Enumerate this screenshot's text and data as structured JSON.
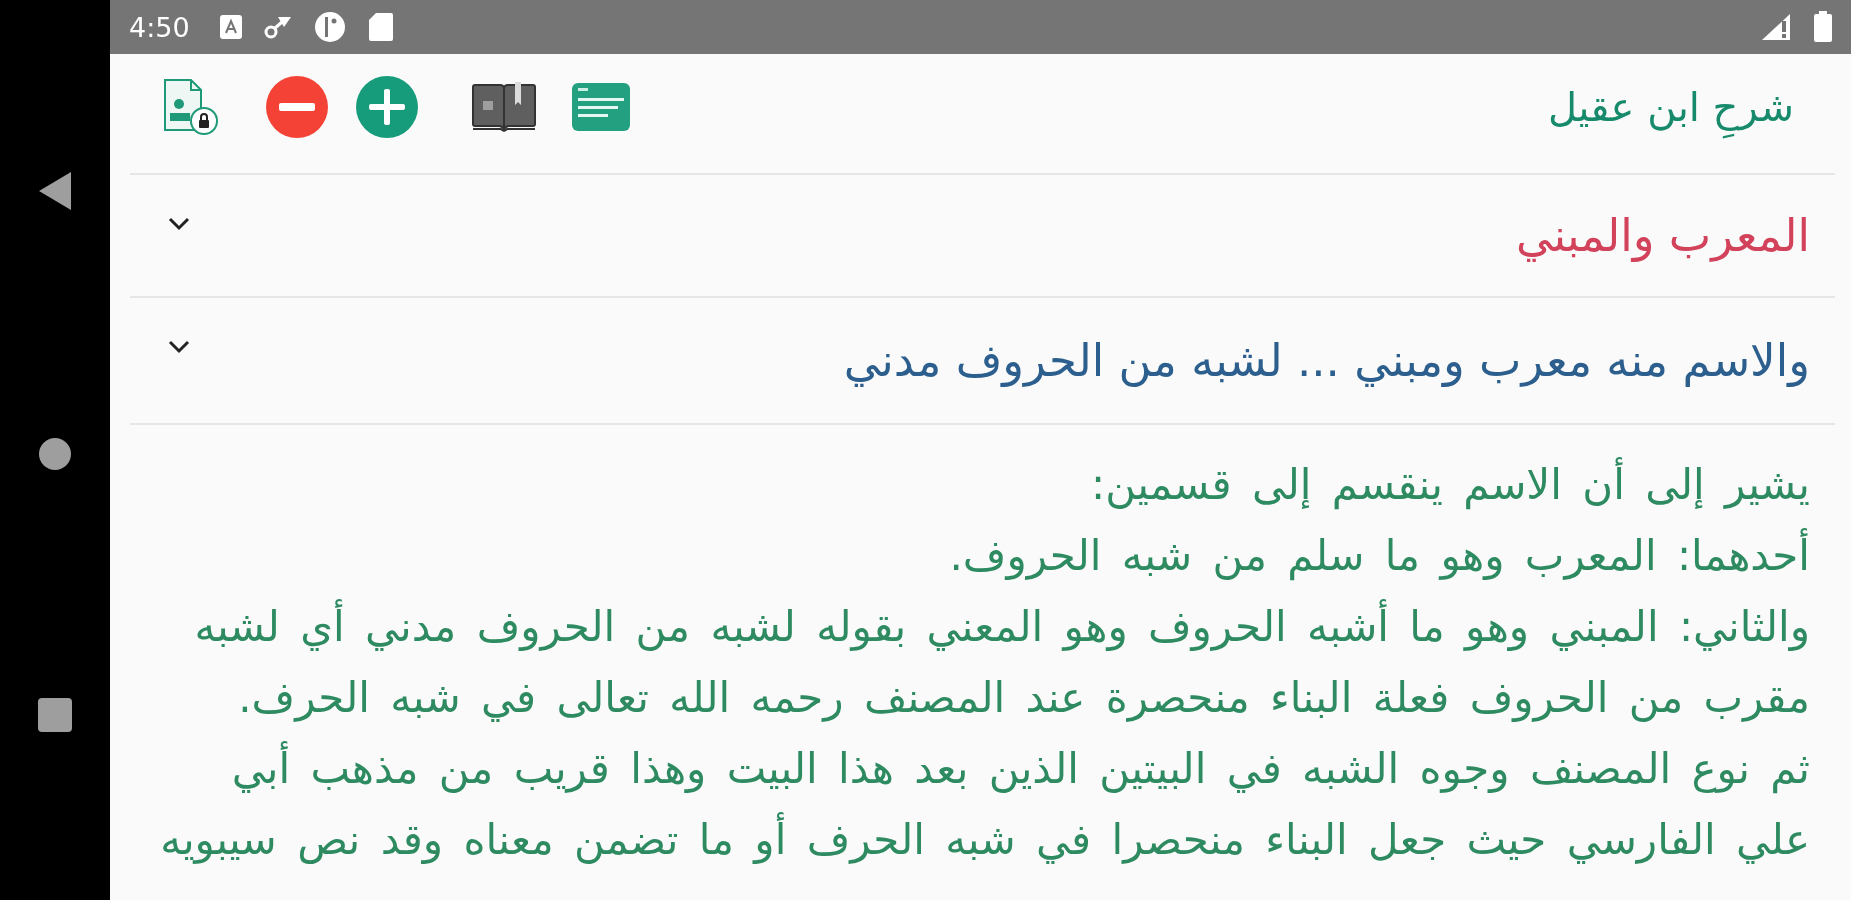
{
  "status_bar": {
    "time": "4:50"
  },
  "toolbar": {
    "title": "شرحِ ابن عقيل"
  },
  "sections": [
    {
      "kind": "chapter",
      "title": "المعرب والمبني"
    },
    {
      "kind": "verse",
      "title": "والاسم منه معرب ومبني ... لشبه من الحروف مدني"
    }
  ],
  "body": {
    "paragraphs": [
      "يشير إلى أن الاسم ينقسم إلى قسمين:",
      "أحدهما: المعرب وهو ما سلم من شبه الحروف.",
      "والثاني: المبني وهو ما أشبه الحروف وهو المعني بقوله لشبه من الحروف مدني أي لشبه مقرب من الحروف فعلة البناء منحصرة عند المصنف رحمه الله تعالى في شبه الحرف.",
      "ثم نوع المصنف وجوه الشبه في البيتين الذين بعد هذا البيت وهذا قريب من مذهب أبي علي الفارسي حيث جعل البناء منحصرا في شبه الحرف أو ما تضمن معناه وقد نص سيبويه"
    ]
  }
}
